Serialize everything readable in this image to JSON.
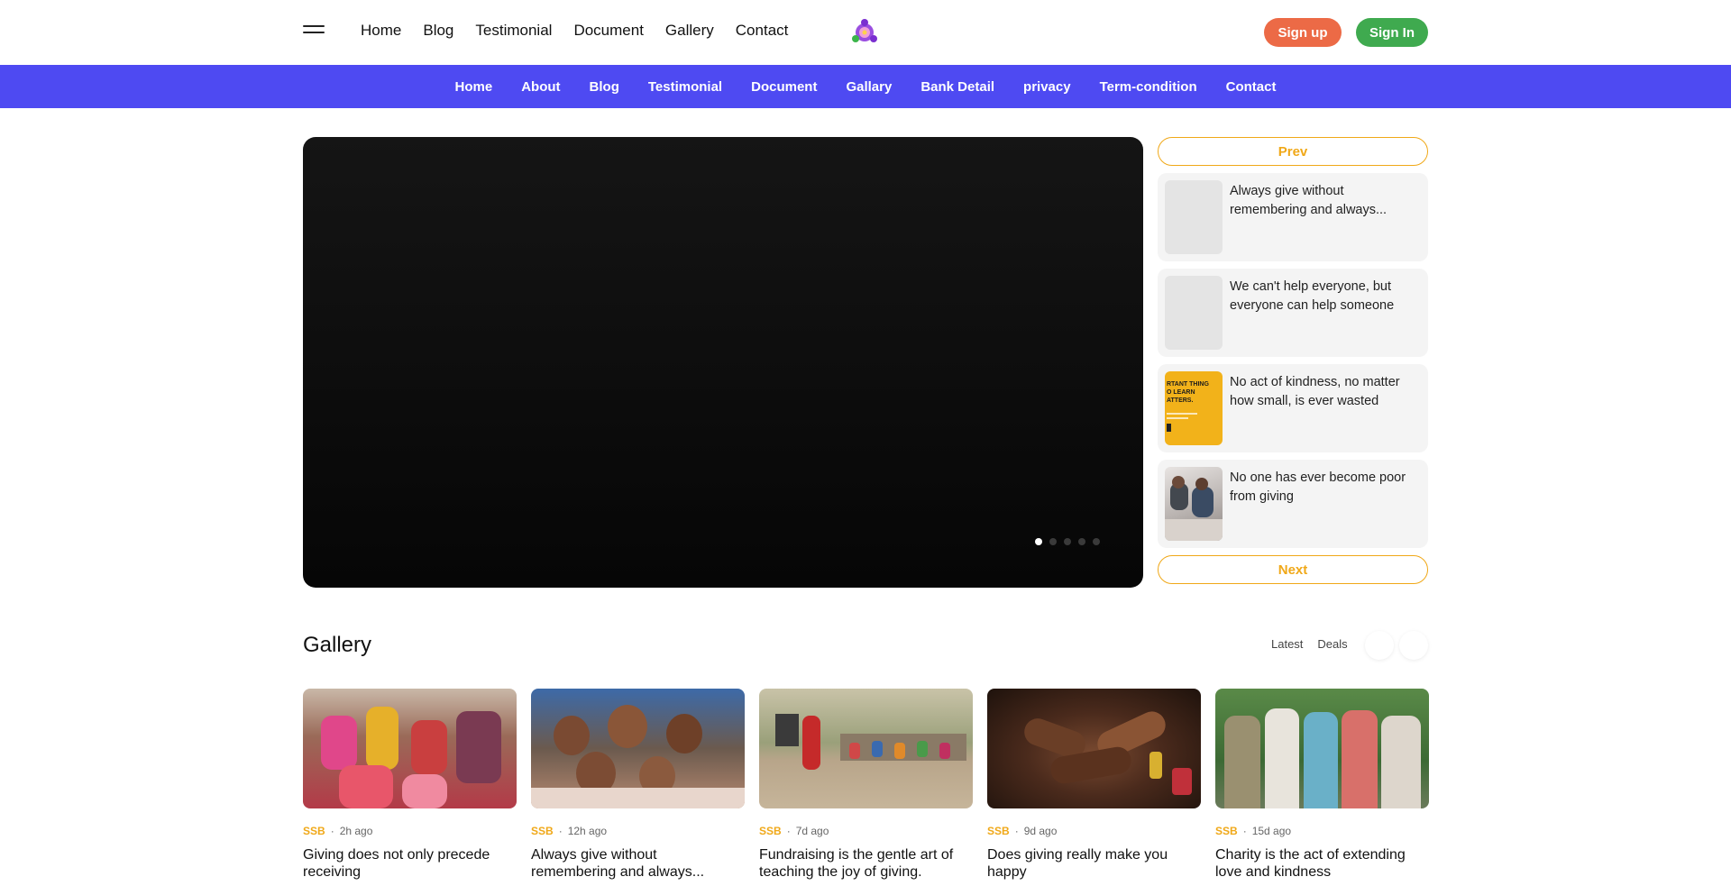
{
  "header": {
    "nav": [
      "Home",
      "Blog",
      "Testimonial",
      "Document",
      "Gallery",
      "Contact"
    ],
    "signup_label": "Sign up",
    "signin_label": "Sign In"
  },
  "subnav": [
    "Home",
    "About",
    "Blog",
    "Testimonial",
    "Document",
    "Gallary",
    "Bank Detail",
    "privacy",
    "Term-condition",
    "Contact"
  ],
  "hero": {
    "slides": 5,
    "active_slide": 1
  },
  "side": {
    "prev_label": "Prev",
    "next_label": "Next",
    "items": [
      {
        "text": "Always give without remembering and always..."
      },
      {
        "text": "We can't help everyone, but everyone can help someone"
      },
      {
        "text": "No act of kindness, no matter how small, is ever wasted",
        "thumb_text": "RTANT THING\nO LEARN\nATTERS."
      },
      {
        "text": "No one has ever become poor from giving"
      }
    ]
  },
  "gallery": {
    "title": "Gallery",
    "filters": [
      "Latest",
      "Deals"
    ],
    "cards": [
      {
        "source": "SSB",
        "time": "2h ago",
        "title": "Giving does not only precede receiving"
      },
      {
        "source": "SSB",
        "time": "12h ago",
        "title": "Always give without remembering and always..."
      },
      {
        "source": "SSB",
        "time": "7d ago",
        "title": "Fundraising is the gentle art of teaching the joy of giving."
      },
      {
        "source": "SSB",
        "time": "9d ago",
        "title": "Does giving really make you happy"
      },
      {
        "source": "SSB",
        "time": "15d ago",
        "title": "Charity is the act of extending love and kindness"
      }
    ]
  },
  "colors": {
    "accent_purple": "#4e4af2",
    "signup": "#ec6a46",
    "signin": "#3faa4f",
    "gold": "#f0a818"
  }
}
